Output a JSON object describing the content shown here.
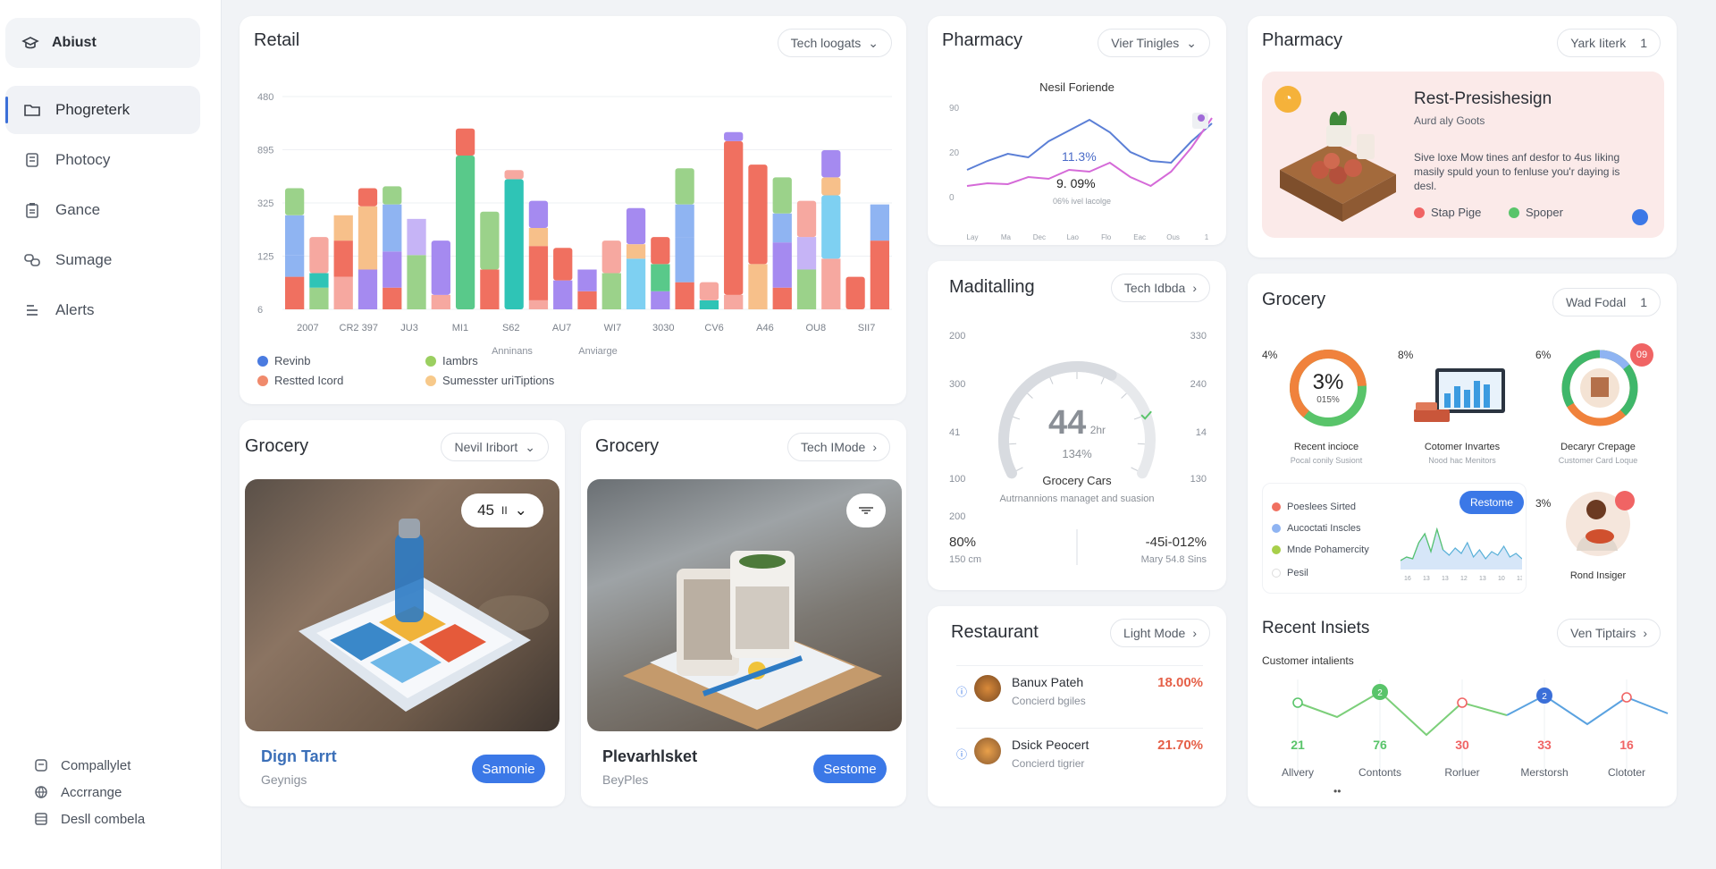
{
  "sidebar": {
    "brand": "Abiust",
    "items": [
      {
        "label": "Phogreterk",
        "icon": "folder-icon"
      },
      {
        "label": "Photocy",
        "icon": "building-icon"
      },
      {
        "label": "Gance",
        "icon": "clipboard-icon"
      },
      {
        "label": "Sumage",
        "icon": "link-icon"
      },
      {
        "label": "Alerts",
        "icon": "list-icon"
      }
    ],
    "footer": [
      {
        "label": "Compallylet",
        "icon": "archive-icon"
      },
      {
        "label": "Accrrange",
        "icon": "globe-icon"
      },
      {
        "label": "Desll combela",
        "icon": "database-icon"
      }
    ]
  },
  "retail": {
    "title": "Retail",
    "filter": "Tech loogats",
    "chart_data": {
      "type": "bar",
      "title": "",
      "yticks": [
        "480",
        "895",
        "325",
        "125",
        "6"
      ],
      "categories": [
        "2007",
        "CR2 397",
        "JU3",
        "MI1",
        "S62",
        "AU7",
        "WI7",
        "3030",
        "CV6",
        "A46",
        "OU8",
        "SII7"
      ],
      "axis_caption": [
        "Anninans",
        "Anviarge"
      ],
      "legend": [
        {
          "name": "Revinb",
          "color": "#4a7be0"
        },
        {
          "name": "Iambrs",
          "color": "#9bcf60"
        },
        {
          "name": "Restted Icord",
          "color": "#f08a6c"
        },
        {
          "name": "Sumesster uriTiptions",
          "color": "#f7c98a"
        }
      ],
      "series": [
        {
          "name": "Revinb",
          "values": [
            0.18,
            0.12,
            0.18,
            0.22,
            0.12,
            0.3,
            0.08,
            0,
            0.22,
            0,
            0.05,
            0.16,
            0.1,
            0.2,
            0,
            0.1,
            0.15,
            0,
            0.08,
            0,
            0.12,
            0.22,
            0.28,
            0,
            0.38
          ]
        },
        {
          "name": "Iambrs",
          "values": [
            0.12,
            0.08,
            0.2,
            0.35,
            0.2,
            0.2,
            0,
            0.85,
            0,
            0.72,
            0.3,
            0,
            0.12,
            0,
            0.28,
            0.15,
            0.25,
            0.05,
            0.85,
            0.25,
            0.25,
            0,
            0.35,
            0,
            0.2
          ]
        },
        {
          "name": "Restted Icord",
          "values": [
            0.22,
            0,
            0.14,
            0,
            0.26,
            0,
            0,
            0,
            0,
            0,
            0.1,
            0,
            0,
            0,
            0.08,
            0,
            0.18,
            0,
            0,
            0,
            0.16,
            0.18,
            0.1,
            0,
            0
          ]
        },
        {
          "name": "Sumesster uriTiptions",
          "values": [
            0.15,
            0.2,
            0,
            0.1,
            0.1,
            0,
            0.3,
            0.15,
            0.32,
            0.05,
            0.15,
            0.18,
            0,
            0.18,
            0.2,
            0.15,
            0.2,
            0.1,
            0.05,
            0.55,
            0.2,
            0.2,
            0.15,
            0.18,
            0
          ]
        }
      ],
      "colors": [
        "#8fb4f2",
        "#2fc4b6",
        "#f07060",
        "#f7c08a",
        "#a58af0",
        "#c6b4f6",
        "#7ed0f2",
        "#59c98a"
      ]
    }
  },
  "pharmacy_chart": {
    "title": "Pharmacy",
    "filter": "Vier Tinigles",
    "chart_data": {
      "type": "line",
      "title": "Nesil Foriende",
      "yticks": [
        "90",
        "20",
        "0"
      ],
      "xticks": [
        "Lay",
        "Ma",
        "Dec",
        "Lao",
        "Flo",
        "Eac",
        "Ous",
        "1"
      ],
      "annotations": [
        "11.3%",
        "9. 09%",
        "06% ivel lacolge"
      ],
      "series": [
        {
          "name": "",
          "color": "#5b7fd6",
          "values": [
            30,
            40,
            48,
            44,
            62,
            74,
            86,
            72,
            50,
            40,
            38,
            62,
            82
          ]
        },
        {
          "name": "",
          "color": "#d56ad8",
          "values": [
            12,
            15,
            14,
            22,
            20,
            30,
            28,
            38,
            22,
            12,
            28,
            55,
            88
          ]
        }
      ]
    }
  },
  "monitoring": {
    "title": "Maditalling",
    "filter": "Tech Idbda",
    "left_ticks": [
      "200",
      "300",
      "41",
      "100",
      "200"
    ],
    "right_ticks": [
      "330",
      "240",
      "14",
      "130"
    ],
    "value": "44",
    "value_unit": "2hr",
    "sub_value": "134%",
    "gauge_label": "Grocery Cars",
    "gauge_caption": "Autrnannions managet and suasion",
    "gauge_level": 0.62,
    "stat_left": "80%",
    "stat_left_sub": "150 cm",
    "stat_right": "-45i-012%",
    "stat_right_sub": "Mary 54.8 Sins"
  },
  "restaurant": {
    "title": "Restaurant",
    "filter": "Light Mode",
    "rows": [
      {
        "name": "Banux Pateh",
        "sub": "Concierd bgiles",
        "value": "18.00%"
      },
      {
        "name": "Dsick Peocert",
        "sub": "Concierd tigrier",
        "value": "21.70%"
      }
    ]
  },
  "pharmacy_promo": {
    "title": "Pharmacy",
    "filter": "Yark Iiterk",
    "filter_count": "1",
    "headline": "Rest-Presishesign",
    "subhead": "Aurd aly Goots",
    "body": "Sive loxe Mow tines anf desfor to 4us Iiking masily spuld youn to fenluse you'r daying is desl.",
    "tag1": "Stap Pige",
    "tag2": "Spoper",
    "tag1_color": "#f06464",
    "tag2_color": "#59c46a"
  },
  "grocery_panel": {
    "title": "Grocery",
    "filter": "Wad Fodal",
    "filter_count": "1",
    "tiles": [
      {
        "pct": "4%",
        "center": "3%",
        "center_sub": "015%",
        "label": "Recent incioce",
        "sub": "Pocal conily Susiont"
      },
      {
        "pct": "8%",
        "label": "Cotomer Invartes",
        "sub": "Nood hac Menitors"
      },
      {
        "pct": "6%",
        "badge": "09",
        "label": "Decaryr Crepage",
        "sub": "Customer Card Loque"
      },
      {
        "pct": "3%",
        "label": "Rond Insiger"
      }
    ],
    "list": [
      "Poeslees Sirted",
      "Aucoctati Inscles",
      "Mnde Pohamercity",
      "Pesil"
    ],
    "list_colors": [
      "#f07060",
      "#8fb4f2",
      "#a8cf4a",
      "#ffffff"
    ],
    "button": "Restome",
    "spark_ticks": [
      "16",
      "13",
      "13",
      "12",
      "13",
      "10",
      "13"
    ]
  },
  "insights": {
    "title": "Recent Insiets",
    "filter": "Ven Tiptairs",
    "subtitle": "Customer intalients",
    "points": [
      {
        "value": "21",
        "label": "Allvery",
        "color": "#59c46a",
        "marker": ""
      },
      {
        "value": "76",
        "label": "Contonts",
        "color": "#59c46a",
        "marker": "2"
      },
      {
        "value": "30",
        "label": "Rorluer",
        "color": "#f06464",
        "marker": ""
      },
      {
        "value": "33",
        "label": "Merstorsh",
        "color": "#f06464",
        "marker": "2"
      },
      {
        "value": "16",
        "label": "Clototer",
        "color": "#f06464",
        "marker": ""
      }
    ]
  },
  "grocery1": {
    "title": "Grocery",
    "filter": "Nevil Iribort",
    "badge": "45",
    "badge_unit": "II",
    "name": "Dign Tarrt",
    "sub": "Geynigs",
    "button": "Samonie"
  },
  "grocery2": {
    "title": "Grocery",
    "filter": "Tech IMode",
    "name": "Plevarhlsket",
    "sub": "BeyPles",
    "button": "Sestome"
  }
}
